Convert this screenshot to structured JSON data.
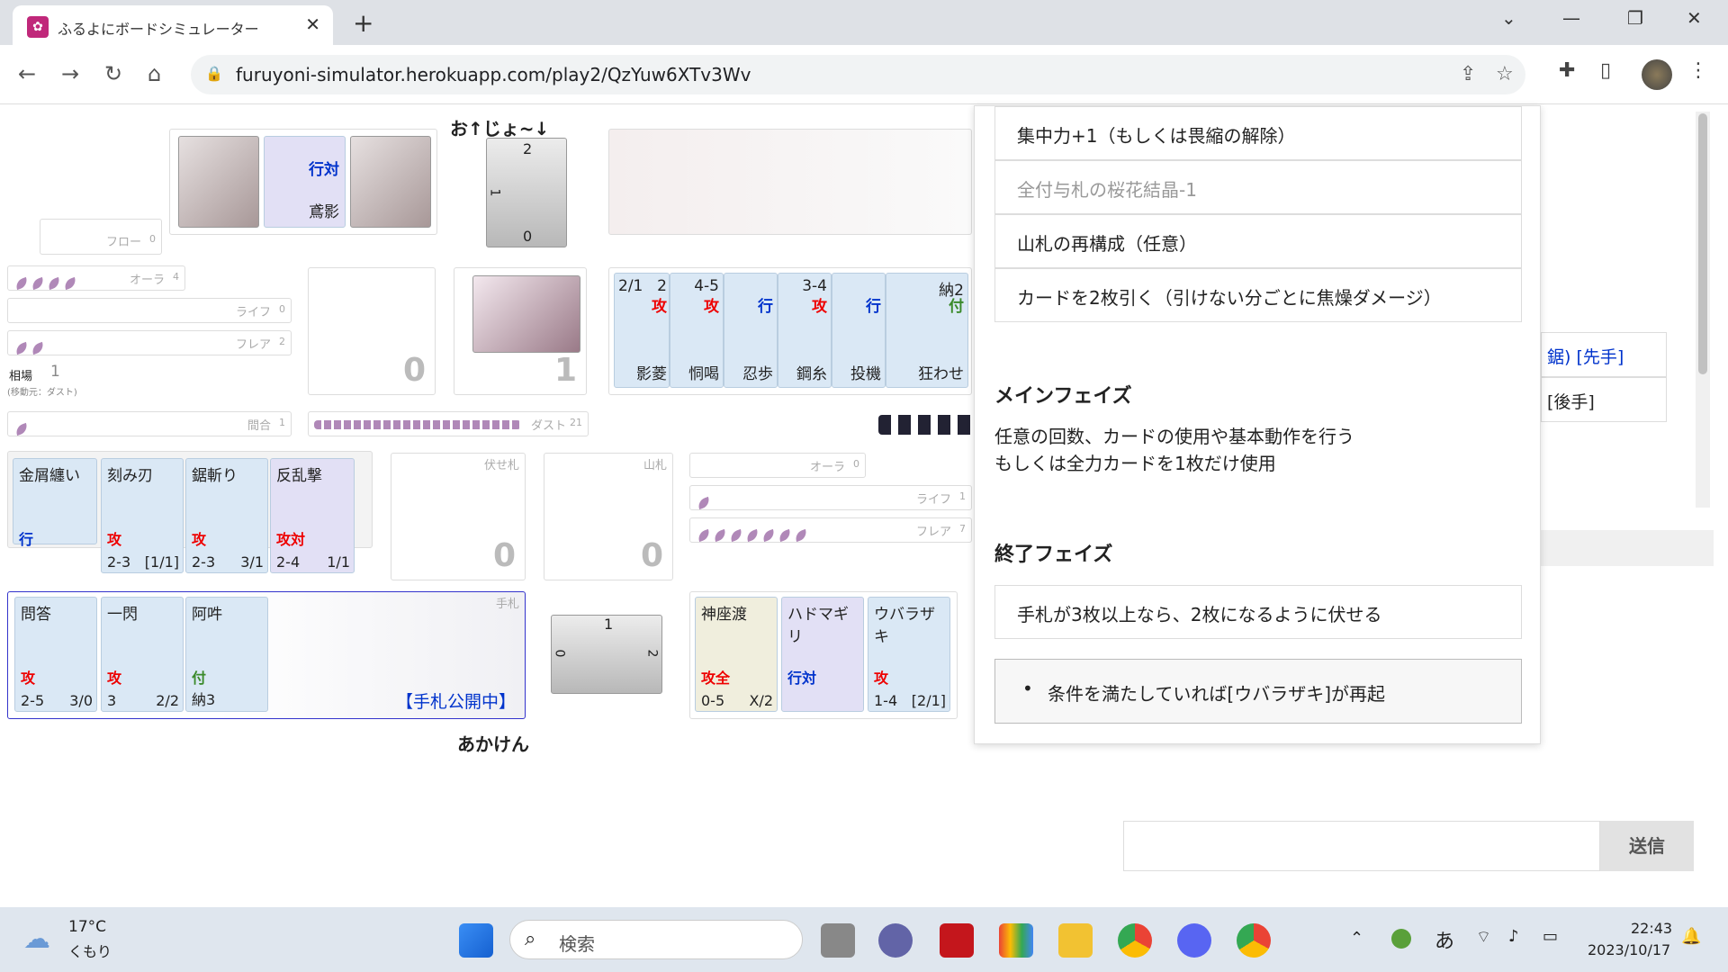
{
  "browser": {
    "tab_title": "ふるよにボードシミュレーター",
    "tab_close": "✕",
    "new_tab": "+",
    "url": "furuyoni-simulator.herokuapp.com/play2/QzYuw6XTv3Wv",
    "window": {
      "collapse": "⌄",
      "minimize": "—",
      "restore": "❐",
      "close": "✕"
    }
  },
  "opponent": {
    "name": "お↑じょ~↓",
    "flow_label": "フロー",
    "flow_value": "0",
    "aura_label": "オーラ",
    "aura_value": "4",
    "aura_petals": 4,
    "life_label": "ライフ",
    "life_value": "0",
    "flare_label": "フレア",
    "flare_value": "2",
    "flare_petals": 2,
    "ma_label": "間合",
    "ma_value": "1",
    "ma_petals": 1,
    "used_cards": [
      {
        "type": "行対",
        "name": "鳶影"
      }
    ],
    "deck_count": "0",
    "discard_count": "1",
    "pile_top": "2",
    "pile_bottom": "0",
    "pile_left": "1"
  },
  "soba": {
    "label": "相場",
    "value": "1",
    "sub": "(移動元：ダスト)"
  },
  "dust": {
    "label": "ダスト",
    "value": "21",
    "petals": 21
  },
  "opponent_row": [
    {
      "range": "2/1",
      "dmg": "2",
      "type": "攻",
      "name": "影菱",
      "cls": "red"
    },
    {
      "range": "4-5",
      "type": "攻",
      "name": "恫喝",
      "cls": "red"
    },
    {
      "type": "行",
      "name": "忍歩",
      "cls": "blue"
    },
    {
      "range": "3-4",
      "type": "攻",
      "name": "鋼糸",
      "cls": "red"
    },
    {
      "type": "行",
      "name": "投機",
      "cls": "blue"
    },
    {
      "range": "納2",
      "type": "付",
      "name": "狂わせ",
      "cls": "green"
    }
  ],
  "player": {
    "name": "あかけん",
    "aura_label": "オーラ",
    "aura_value": "0",
    "life_label": "ライフ",
    "life_value": "1",
    "life_petals": 1,
    "flare_label": "フレア",
    "flare_value": "7",
    "flare_petals": 7,
    "fuse_label": "伏せ札",
    "fuse_count": "0",
    "deck_label": "山札",
    "deck_count": "0",
    "hand_label": "手札",
    "hand_open": "【手札公開中】",
    "pile_top": "1",
    "pile_left": "0",
    "pile_right": "2",
    "used": [
      {
        "name": "金屑纏い",
        "type": "行",
        "cls": "blue",
        "stat": "",
        "stat2": ""
      },
      {
        "name": "刻み刃",
        "type": "攻",
        "cls": "red",
        "stat": "2-3",
        "stat2": "[1/1]"
      },
      {
        "name": "鋸斬り",
        "type": "攻",
        "cls": "red",
        "stat": "2-3",
        "stat2": "3/1"
      },
      {
        "name": "反乱撃",
        "type": "攻対",
        "cls": "red",
        "stat": "2-4",
        "stat2": "1/1"
      }
    ],
    "hand": [
      {
        "name": "問答",
        "type": "攻",
        "cls": "red",
        "stat": "2-5",
        "stat2": "3/0"
      },
      {
        "name": "一閃",
        "type": "攻",
        "cls": "red",
        "stat": "3",
        "stat2": "2/2"
      },
      {
        "name": "阿吽",
        "type": "付",
        "cls": "green",
        "stat": "納3",
        "stat2": ""
      }
    ],
    "special": [
      {
        "name": "神座渡",
        "type": "攻全",
        "cls": "red",
        "stat": "0-5",
        "stat2": "X/2"
      },
      {
        "name": "ハドマギリ",
        "type": "行対",
        "cls": "blue",
        "stat": "",
        "stat2": ""
      },
      {
        "name": "ウバラザキ",
        "type": "攻",
        "cls": "red",
        "stat": "1-4",
        "stat2": "[2/1]"
      }
    ]
  },
  "panel": {
    "steps_top": [
      {
        "text": "集中力+1（もしくは畏縮の解除）",
        "muted": false
      },
      {
        "text": "全付与札の桜花結晶-1",
        "muted": true
      },
      {
        "text": "山札の再構成（任意）",
        "muted": false
      },
      {
        "text": "カードを2枚引く（引けない分ごとに焦燥ダメージ）",
        "muted": false
      }
    ],
    "main_title": "メインフェイズ",
    "main_line1": "任意の回数、カードの使用や基本動作を行う",
    "main_line2": "もしくは全力カードを1枚だけ使用",
    "end_title": "終了フェイズ",
    "end_step": "手札が3枚以上なら、2枚になるように伏せる",
    "end_note": "条件を満たしていれば[ウバラザキ]が再起"
  },
  "side": {
    "p1_suffix": "鋸) [先手]",
    "p2_suffix": "[後手]",
    "send": "送信"
  },
  "taskbar": {
    "weather_temp": "17°C",
    "weather_desc": "くもり",
    "search": "検索",
    "time": "22:43",
    "date": "2023/10/17",
    "ime": "あ"
  }
}
